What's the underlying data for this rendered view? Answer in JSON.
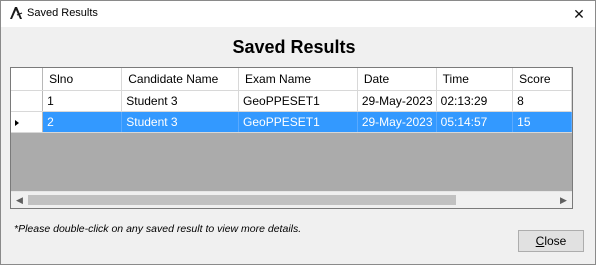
{
  "window": {
    "title": "Saved Results",
    "close_glyph": "✕"
  },
  "heading": "Saved Results",
  "grid": {
    "columns": [
      "Slno",
      "Candidate Name",
      "Exam Name",
      "Date",
      "Time",
      "Score"
    ],
    "rows": [
      {
        "slno": "1",
        "candidate": "Student 3",
        "exam": "GeoPPESET1",
        "date": "29-May-2023",
        "time": "02:13:29",
        "score": "8",
        "selected": false
      },
      {
        "slno": "2",
        "candidate": "Student 3",
        "exam": "GeoPPESET1",
        "date": "29-May-2023",
        "time": "05:14:57",
        "score": "15",
        "selected": true
      }
    ],
    "scroll_left_glyph": "◀",
    "scroll_right_glyph": "▶",
    "selection_color": "#3399ff"
  },
  "note": "*Please double-click on any saved result to view  more details.",
  "close_button": {
    "label_rest": "lose",
    "label_mnemonic": "C"
  }
}
